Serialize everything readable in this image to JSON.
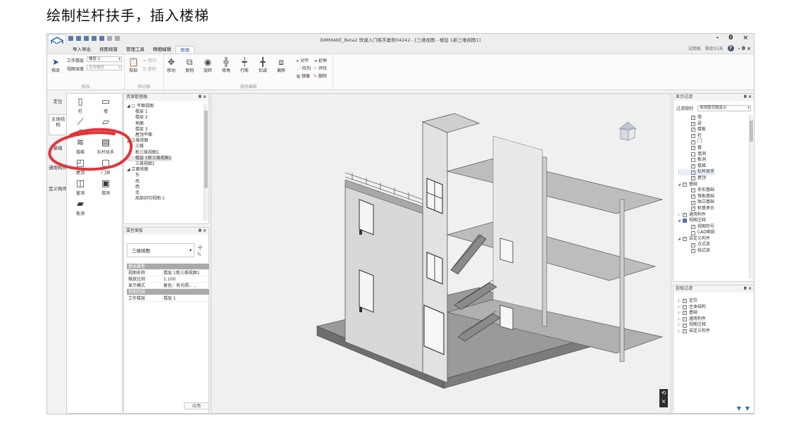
{
  "caption": "绘制栏杆扶手，插入楼梯",
  "app": {
    "title": "BIMMAKE_Beta2 快速入门练手案例04242 - [三维视图 - 楼层 1新三维视图1]",
    "window_controls": [
      "-",
      "θ",
      "×"
    ],
    "menu_tabs": [
      "导入导出",
      "视图视窗",
      "管理工具",
      "精细编辑",
      "修改"
    ],
    "active_tab": "修改",
    "right_menu": {
      "trial": "试用版",
      "remaining": "剩余55天",
      "help": "?",
      "controls": "- θ ×"
    }
  },
  "ribbon": {
    "modify": {
      "label": "修改",
      "work_floor_label": "工作楼层",
      "work_floor_value": "楼层 1",
      "view_depth_label": "视图深度",
      "view_depth_value": "全部楼层",
      "group": "修改"
    },
    "clipboard": {
      "paste": "粘贴",
      "cut": "剪切",
      "copy": "复制",
      "group": "剪切板"
    },
    "general_edit": {
      "tools": [
        "移动",
        "复制",
        "旋转",
        "修角",
        "打断",
        "扣减",
        "偏移"
      ],
      "align": "对齐",
      "extend": "延伸",
      "array": "阵列",
      "ring_array": "环阵",
      "mirror": "镜像",
      "delete": "删除",
      "group": "通用编辑"
    }
  },
  "left_tabs": [
    "定位",
    "主体结构",
    "基础",
    "通用构件",
    "定义构件"
  ],
  "palette": {
    "tools": [
      {
        "label": "柱",
        "icon": "column-icon",
        "glyph": "▯"
      },
      {
        "label": "墙",
        "icon": "wall-icon",
        "glyph": "▭"
      },
      {
        "label": "梁",
        "icon": "beam-icon",
        "glyph": "⟋"
      },
      {
        "label": "楼板",
        "icon": "slab-icon",
        "glyph": "▱"
      },
      {
        "label": "楼梯",
        "icon": "stair-icon",
        "glyph": "≋"
      },
      {
        "label": "栏杆扶手",
        "icon": "railing-icon",
        "glyph": "▤"
      },
      {
        "label": "屋顶",
        "icon": "roof-icon",
        "glyph": "◰"
      },
      {
        "label": "门洞",
        "icon": "door-opening-icon",
        "glyph": "▢"
      },
      {
        "label": "窗洞",
        "icon": "window-opening-icon",
        "glyph": "◫"
      },
      {
        "label": "墙洞",
        "icon": "wall-opening-icon",
        "glyph": "▣"
      },
      {
        "label": "板洞",
        "icon": "slab-opening-icon",
        "glyph": "▰"
      }
    ]
  },
  "resource_manager": {
    "title": "资源管理器",
    "pin": "θ ×",
    "tree": [
      {
        "text": "◢ ▢ 平面视图",
        "indent": 0
      },
      {
        "text": "楼层 1",
        "indent": 2
      },
      {
        "text": "楼层 2",
        "indent": 2
      },
      {
        "text": "地面",
        "indent": 2
      },
      {
        "text": "楼层 3",
        "indent": 2
      },
      {
        "text": "屋顶平面",
        "indent": 2
      },
      {
        "text": "◢ 三维视图",
        "indent": 0
      },
      {
        "text": "三维",
        "indent": 2
      },
      {
        "text": "新三维视图1",
        "indent": 2
      },
      {
        "text": "楼层 1新三维视图1",
        "indent": 2,
        "selected": true
      },
      {
        "text": "三维视图1",
        "indent": 2
      },
      {
        "text": "◢ 立面视图",
        "indent": 0
      },
      {
        "text": "东",
        "indent": 2
      },
      {
        "text": "南",
        "indent": 2
      },
      {
        "text": "西",
        "indent": 2
      },
      {
        "text": "北",
        "indent": 2
      },
      {
        "text": "局部剖切视图-1",
        "indent": 2
      }
    ]
  },
  "properties": {
    "title": "属性面板",
    "pin": "θ ×",
    "type": "三维视图",
    "rows": [
      {
        "k": "基本属性",
        "v": "",
        "hdr": true
      },
      {
        "k": "视图名称",
        "v": "楼层 1新三维视图1"
      },
      {
        "k": "缩放比例",
        "v": "1:100"
      },
      {
        "k": "显示模式",
        "v": "着色：有光照，..."
      },
      {
        "k": "视图范围",
        "v": "",
        "hdr": true
      },
      {
        "k": "工作楼层",
        "v": "楼层 1"
      }
    ],
    "apply": "应用"
  },
  "display_filter": {
    "title": "显示过滤",
    "pin": "θ ×",
    "rule_label": "过滤规则",
    "rule_value": "按视图范围显示",
    "items": [
      {
        "text": "墙",
        "state": "on",
        "indent": 1
      },
      {
        "text": "梁",
        "state": "on",
        "indent": 1
      },
      {
        "text": "楼板",
        "state": "on",
        "indent": 1
      },
      {
        "text": "柱",
        "state": "on",
        "indent": 1
      },
      {
        "text": "门",
        "state": "on",
        "indent": 1
      },
      {
        "text": "窗",
        "state": "on",
        "indent": 1
      },
      {
        "text": "墙洞",
        "state": "off",
        "indent": 1
      },
      {
        "text": "板洞",
        "state": "off",
        "indent": 1
      },
      {
        "text": "楼梯",
        "state": "on",
        "indent": 1
      },
      {
        "text": "栏杆扶手",
        "state": "on",
        "indent": 1
      },
      {
        "text": "屋顶",
        "state": "on",
        "indent": 1
      },
      {
        "text": "基础",
        "state": "on",
        "indent": 0,
        "tri": "◢"
      },
      {
        "text": "条形基础",
        "state": "on",
        "indent": 1
      },
      {
        "text": "筏板基础",
        "state": "on",
        "indent": 1
      },
      {
        "text": "独立基础",
        "state": "on",
        "indent": 1
      },
      {
        "text": "桩基承台",
        "state": "on",
        "indent": 1
      },
      {
        "text": "通用构件",
        "state": "on",
        "indent": 0,
        "tri": "▷"
      },
      {
        "text": "视图注释",
        "state": "part",
        "indent": 0,
        "tri": "◢"
      },
      {
        "text": "视图符号",
        "state": "on",
        "indent": 1
      },
      {
        "text": "CAD图纸",
        "state": "off",
        "indent": 1
      },
      {
        "text": "自定义构件",
        "state": "on",
        "indent": 0,
        "tri": "◢"
      },
      {
        "text": "点式族",
        "state": "on",
        "indent": 1
      },
      {
        "text": "线式族",
        "state": "on",
        "indent": 1
      }
    ]
  },
  "pick_filter": {
    "title": "拾取过滤",
    "pin": "θ ×",
    "items": [
      "定位",
      "主体结构",
      "基础",
      "通用构件",
      "视图注释",
      "自定义构件"
    ]
  },
  "viewport": {
    "nav_glyphs": [
      "⟲",
      "×"
    ]
  },
  "colors": {
    "accent": "#1a4a8a",
    "annotation": "#e5333a",
    "filter_icon": "#2f6fb7"
  }
}
